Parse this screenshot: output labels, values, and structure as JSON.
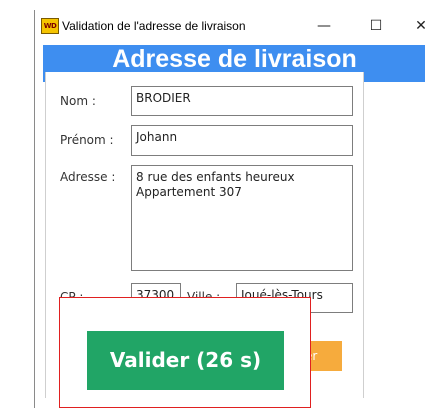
{
  "window": {
    "icon_text": "WD",
    "title": "Validation de l'adresse de livraison",
    "minimize_glyph": "—",
    "maximize_glyph": "☐",
    "close_glyph": "✕"
  },
  "header": {
    "title": "Adresse de livraison"
  },
  "form": {
    "nom_label": "Nom :",
    "nom_value": "BRODIER",
    "prenom_label": "Prénom :",
    "prenom_value": "Johann",
    "adresse_label": "Adresse :",
    "adresse_value": "8 rue des enfants heureux\nAppartement 307",
    "cp_label": "CP :",
    "cp_value": "37300",
    "ville_label": "Ville :",
    "ville_value": "Joué-lès-Tours"
  },
  "buttons": {
    "secondary_label": "er",
    "valider_label": "Valider (26 s)"
  },
  "colors": {
    "banner": "#3e8ef0",
    "valider": "#21a566",
    "secondary": "#f6ab3d",
    "highlight_border": "#e02020"
  }
}
